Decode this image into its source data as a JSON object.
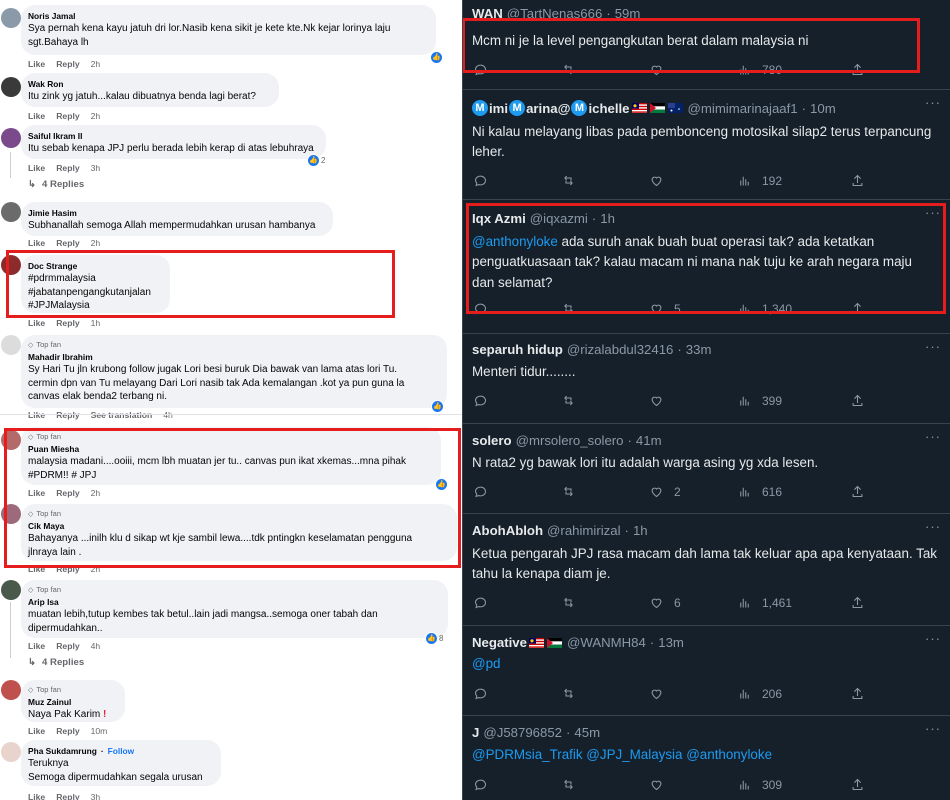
{
  "facebook": {
    "actions": {
      "like": "Like",
      "reply": "Reply"
    },
    "top_fan": "Top fan",
    "follow": "Follow",
    "comments": [
      {
        "name": "Noris Jamal",
        "lines": [
          "Sya pernah kena kayu jatuh dri lor.Nasib kena sikit je kete kte.Nk kejar lorinya laju",
          "sgt.Bahaya lh"
        ],
        "time": "2h",
        "reactions": ""
      },
      {
        "name": "Wak Ron",
        "lines": [
          "Itu zink yg jatuh...kalau dibuatnya benda lagi berat?"
        ],
        "time": "2h"
      },
      {
        "name": "Saiful Ikram II",
        "lines": [
          "Itu sebab kenapa JPJ perlu berada lebih kerap di atas lebuhraya"
        ],
        "time": "3h",
        "reactions": "2",
        "replies": "4 Replies"
      },
      {
        "name": "Jimie Hasim",
        "lines": [
          "Subhanallah semoga Allah mempermudahkan urusan hambanya"
        ],
        "time": "2h"
      },
      {
        "name": "Doc Strange",
        "lines": [
          "#pdrmmalaysia",
          "#jabatanpengangkutanjalan",
          "#JPJMalaysia"
        ],
        "time": "1h"
      },
      {
        "name": "Mahadir Ibrahim",
        "lines": [
          "Sy Hari Tu jln krubong follow jugak Lori besi buruk Dia bawak van lama atas lori Tu.",
          "cermin dpn van Tu melayang Dari Lori nasib tak Ada kemalangan .kot ya pun guna la",
          "canvas elak benda2 terbang ni."
        ],
        "time": "4h",
        "translation": "See translation"
      },
      {
        "name": "Puan Miesha",
        "lines": [
          "malaysia madani....ooiii, mcm lbh muatan jer tu.. canvas pun ikat xkemas...mna pihak",
          "#PDRM!! # JPJ"
        ],
        "time": "2h"
      },
      {
        "name": "Cik Maya",
        "lines": [
          "Bahayanya ...inilh klu d sikap wt kje sambil lewa....tdk pntingkn keselamatan pengguna",
          "jlnraya lain ."
        ],
        "time": "2h"
      },
      {
        "name": "Arip Isa",
        "lines": [
          "muatan lebih,tutup kembes tak betul..lain jadi mangsa..semoga oner tabah dan",
          "dipermudahkan.."
        ],
        "time": "4h",
        "reactions": "8",
        "replies": "4 Replies"
      },
      {
        "name": "Muz Zainul",
        "lines": [
          "Naya Pak Karim"
        ],
        "time": "10m"
      },
      {
        "name": "Pha Sukdamrung",
        "lines": [
          "Teruknya",
          "Semoga dipermudahkan segala urusan"
        ],
        "time": "3h"
      }
    ]
  },
  "twitter": {
    "tweets": [
      {
        "name": "WAN",
        "handle": "@TartNenas666",
        "time": "59m",
        "text": "Mcm ni je la level pengangkutan berat dalam malaysia ni",
        "replies": "",
        "retweets": "",
        "likes": "",
        "views": "780"
      },
      {
        "name_prefix": "M",
        "name_a": "imi",
        "name_b": "arina@",
        "name_c": "ichelle",
        "handle": "@mimimarinajaaf1",
        "time": "10m",
        "text": "Ni kalau melayang libas pada pemboncENG motosikal silap2 terus terpancung leher.",
        "views": "192"
      },
      {
        "name": "Iqx Azmi",
        "handle": "@iqxazmi",
        "time": "1h",
        "mention": "@anthonyloke",
        "text": " ada suruh anak buah buat operasi tak? ada ketatkan penguatkuasaan tak? kalau macam ni mana nak tuju ke arah negara maju dan selamat?",
        "likes": "5",
        "views": "1,340"
      },
      {
        "name": "separuh hidup",
        "handle": "@rizalabdul32416",
        "time": "33m",
        "text": "Menteri tidur........",
        "views": "399"
      },
      {
        "name": "solero",
        "handle": "@mrsolero_solero",
        "time": "41m",
        "text": "N rata2 yg bawak lori itu adalah warga asing yg xda lesen.",
        "likes": "2",
        "views": "616"
      },
      {
        "name": "AbohAbloh",
        "handle": "@rahimirizal",
        "time": "1h",
        "text": "Ketua pengarah JPJ rasa macam dah lama tak keluar apa apa kenyataan. Tak tahu la kenapa diam je.",
        "likes": "6",
        "views": "1,461"
      },
      {
        "name": "Negative",
        "handle": "@WANMH84",
        "time": "13m",
        "mention": "@pd",
        "views": "206"
      },
      {
        "name": "J",
        "handle": "@J58796852",
        "time": "45m",
        "mentions": "@PDRMsia_Trafik @JPJ_Malaysia @anthonyloke",
        "views": "309"
      }
    ]
  },
  "colors": {
    "highlight": "#e51d1d",
    "twitter_bg": "#15202b",
    "fb_blue": "#1877f2",
    "tw_link": "#1d9bf0"
  }
}
